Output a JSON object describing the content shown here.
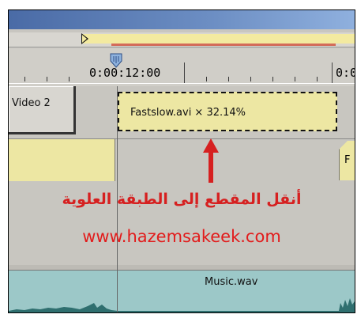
{
  "ruler": {
    "time_start": "0:00:12:00",
    "time_end": "0:0"
  },
  "tracks": {
    "video2_label": "Video 2",
    "right_clip_label": "F"
  },
  "clip": {
    "label": "Fastslow.avi × 32.14%"
  },
  "annotation": {
    "arabic_text": "أنقل المقطع إلى الطبقة العلوية",
    "url": "www.hazemsakeek.com"
  },
  "audio": {
    "track_name": "Music.wav"
  },
  "colors": {
    "clip_yellow": "#ede7a3",
    "annotation_red": "#d62020",
    "audio_teal": "#9cc8c8"
  }
}
